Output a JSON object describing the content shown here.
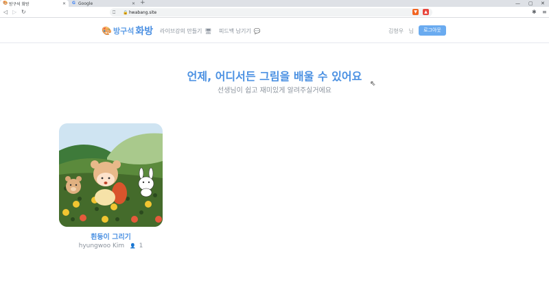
{
  "browser": {
    "tabs": [
      {
        "label": "방구석 화방",
        "favicon": "palette-icon",
        "active": true
      },
      {
        "label": "Google",
        "favicon": "google-icon",
        "active": false
      }
    ],
    "new_tab": "+",
    "url": "hwabang.site"
  },
  "header": {
    "brand_small": "방구석",
    "brand_large": "화방",
    "nav": [
      {
        "label": "라이브강의 만들기",
        "icon": "monitor-icon"
      },
      {
        "label": "피드백 남기기",
        "icon": "chat-icon"
      }
    ],
    "user_name": "김형우",
    "user_suffix": "님",
    "logout_label": "로그아웃"
  },
  "hero": {
    "title": "언제, 어디서든 그림을 배울 수 있어요",
    "subtitle": "선생님이 쉽고 재미있게 알려주실거에요"
  },
  "courses": [
    {
      "title": "흰둥이 그리기",
      "author": "hyungwoo Kim",
      "participants": "1"
    }
  ],
  "colors": {
    "accent": "#4a90e2",
    "button": "#6aabf0",
    "muted": "#8a929c"
  }
}
